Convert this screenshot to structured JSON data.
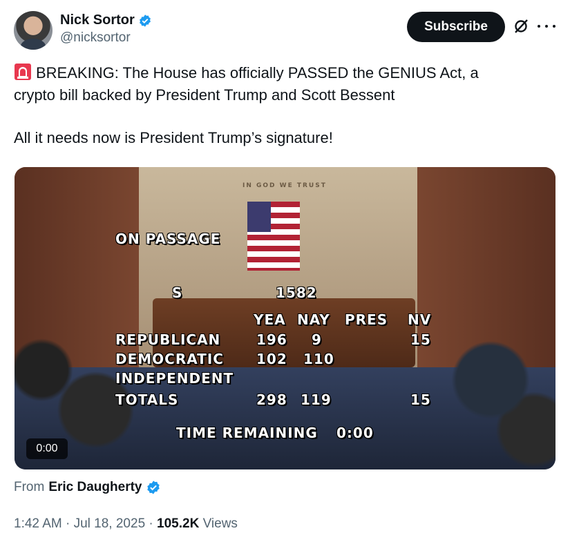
{
  "author": {
    "display_name": "Nick Sortor",
    "handle": "@nicksortor"
  },
  "actions": {
    "subscribe_label": "Subscribe"
  },
  "tweet": {
    "line1": "BREAKING: The House has officially PASSED the GENIUS Act, a",
    "line2": "crypto bill backed by President Trump and Scott Bessent",
    "line3": "All it needs now is President Trump’s signature!"
  },
  "media": {
    "duration": "0:00",
    "wall_inscription": "IN GOD WE TRUST",
    "vote_board": {
      "title": "ON PASSAGE",
      "bill_prefix": "S",
      "bill_number": "1582",
      "columns": [
        "YEA",
        "NAY",
        "PRES",
        "NV"
      ],
      "rows": [
        {
          "party": "REPUBLICAN",
          "yea": "196",
          "nay": "9",
          "pres": "",
          "nv": "15"
        },
        {
          "party": "DEMOCRATIC",
          "yea": "102",
          "nay": "110",
          "pres": "",
          "nv": ""
        },
        {
          "party": "INDEPENDENT",
          "yea": "",
          "nay": "",
          "pres": "",
          "nv": ""
        },
        {
          "party": "TOTALS",
          "yea": "298",
          "nay": "119",
          "pres": "",
          "nv": "15"
        }
      ],
      "time_label": "TIME REMAINING",
      "time_value": "0:00"
    }
  },
  "attribution": {
    "prefix": "From",
    "source_name": "Eric Daugherty"
  },
  "meta": {
    "time": "1:42 AM",
    "date": "Jul 18, 2025",
    "views_count": "105.2K",
    "views_label": "Views"
  },
  "colors": {
    "verified": "#1d9bf0",
    "text_primary": "#0f1419",
    "text_secondary": "#536471",
    "subscribe_bg": "#0f1419"
  }
}
